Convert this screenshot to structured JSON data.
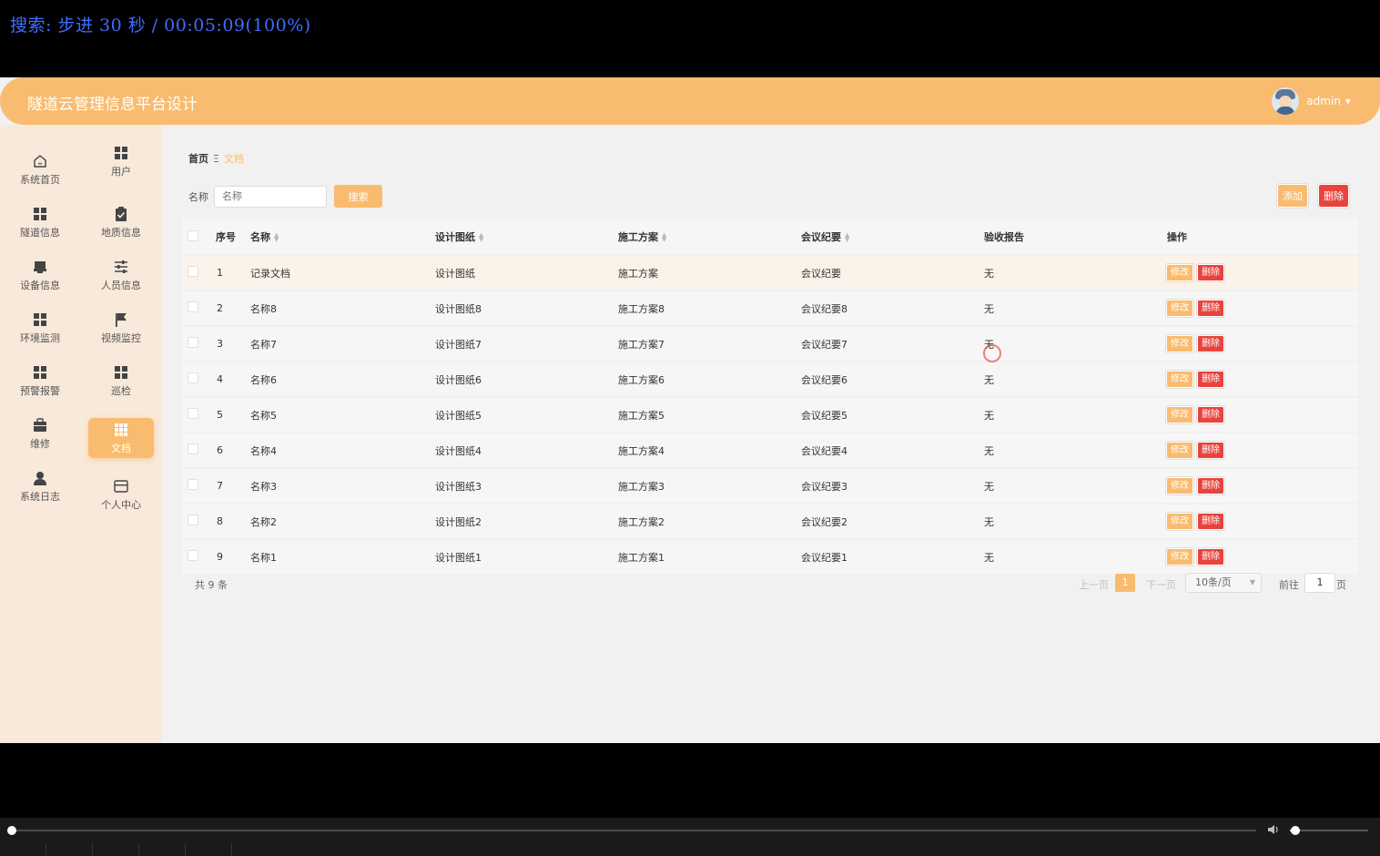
{
  "player": {
    "osd_text": "搜索: 步进 30 秒 / 00:05:09(100%)"
  },
  "app": {
    "title": "隧道云管理信息平台设计",
    "user": "admin"
  },
  "sidebar": {
    "items": [
      {
        "label": "系统首页",
        "icon": "home-icon"
      },
      {
        "label": "用户",
        "icon": "grid-icon"
      },
      {
        "label": "隧道信息",
        "icon": "grid-icon"
      },
      {
        "label": "地质信息",
        "icon": "clipboard-check-icon"
      },
      {
        "label": "设备信息",
        "icon": "device-icon"
      },
      {
        "label": "人员信息",
        "icon": "sliders-icon"
      },
      {
        "label": "环境监测",
        "icon": "grid-icon"
      },
      {
        "label": "视频监控",
        "icon": "flag-icon"
      },
      {
        "label": "预警报警",
        "icon": "grid-icon"
      },
      {
        "label": "巡检",
        "icon": "grid-icon"
      },
      {
        "label": "维修",
        "icon": "briefcase-icon"
      },
      {
        "label": "文档",
        "icon": "grid-nine-icon",
        "active": true
      },
      {
        "label": "系统日志",
        "icon": "user-icon"
      },
      {
        "label": "个人中心",
        "icon": "card-icon"
      }
    ]
  },
  "breadcrumb": {
    "home": "首页",
    "separator": "Ξ",
    "current": "文档"
  },
  "search": {
    "label": "名称",
    "placeholder": "名称",
    "button": "搜索"
  },
  "toolbar": {
    "add": "添加",
    "delete": "删除"
  },
  "table": {
    "headers": {
      "index": "序号",
      "name": "名称",
      "drawing": "设计图纸",
      "plan": "施工方案",
      "minutes": "会议纪要",
      "report": "验收报告",
      "actions": "操作"
    },
    "rows": [
      {
        "index": "1",
        "name": "记录文档",
        "drawing": "设计图纸",
        "plan": "施工方案",
        "minutes": "会议纪要",
        "report": "无"
      },
      {
        "index": "2",
        "name": "名称8",
        "drawing": "设计图纸8",
        "plan": "施工方案8",
        "minutes": "会议纪要8",
        "report": "无"
      },
      {
        "index": "3",
        "name": "名称7",
        "drawing": "设计图纸7",
        "plan": "施工方案7",
        "minutes": "会议纪要7",
        "report": "无"
      },
      {
        "index": "4",
        "name": "名称6",
        "drawing": "设计图纸6",
        "plan": "施工方案6",
        "minutes": "会议纪要6",
        "report": "无"
      },
      {
        "index": "5",
        "name": "名称5",
        "drawing": "设计图纸5",
        "plan": "施工方案5",
        "minutes": "会议纪要5",
        "report": "无"
      },
      {
        "index": "6",
        "name": "名称4",
        "drawing": "设计图纸4",
        "plan": "施工方案4",
        "minutes": "会议纪要4",
        "report": "无"
      },
      {
        "index": "7",
        "name": "名称3",
        "drawing": "设计图纸3",
        "plan": "施工方案3",
        "minutes": "会议纪要3",
        "report": "无"
      },
      {
        "index": "8",
        "name": "名称2",
        "drawing": "设计图纸2",
        "plan": "施工方案2",
        "minutes": "会议纪要2",
        "report": "无"
      },
      {
        "index": "9",
        "name": "名称1",
        "drawing": "设计图纸1",
        "plan": "施工方案1",
        "minutes": "会议纪要1",
        "report": "无"
      }
    ],
    "edit_label": "修改",
    "delete_label": "删除"
  },
  "pagination": {
    "total": "共 9 条",
    "prev": "上一页",
    "current": "1",
    "next": "下一页",
    "page_size": "10条/页",
    "goto_label": "前往",
    "goto_value": "1",
    "page_suffix": "页"
  },
  "playback": {
    "progress": 0.0
  },
  "colors": {
    "accent": "#f9bb6f",
    "danger": "#e8433e",
    "osd": "#3f6dff"
  }
}
